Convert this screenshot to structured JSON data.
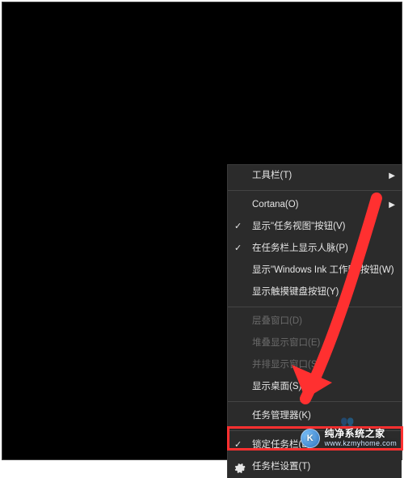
{
  "menu": {
    "toolbars": {
      "label": "工具栏(T)",
      "has_submenu": true
    },
    "cortana": {
      "label": "Cortana(O)",
      "has_submenu": true
    },
    "taskview": {
      "label": "显示\"任务视图\"按钮(V)",
      "checked": true
    },
    "people": {
      "label": "在任务栏上显示人脉(P)",
      "checked": true
    },
    "ink": {
      "label": "显示\"Windows Ink 工作区\"按钮(W)"
    },
    "touchkb": {
      "label": "显示触摸键盘按钮(Y)"
    },
    "cascade": {
      "label": "层叠窗口(D)"
    },
    "stacked": {
      "label": "堆叠显示窗口(E)"
    },
    "sidebyside": {
      "label": "并排显示窗口(S)"
    },
    "showdesk": {
      "label": "显示桌面(S)"
    },
    "taskmgr": {
      "label": "任务管理器(K)"
    },
    "lock": {
      "label": "锁定任务栏(L)",
      "checked": true
    },
    "settings": {
      "label": "任务栏设置(T)"
    }
  },
  "watermark": {
    "title": "纯净系统之家",
    "url": "www.kzmyhome.com",
    "logo_letter": "K"
  },
  "annotation": {
    "arrow_color": "#ff3030",
    "highlight_color": "#ff3030"
  }
}
